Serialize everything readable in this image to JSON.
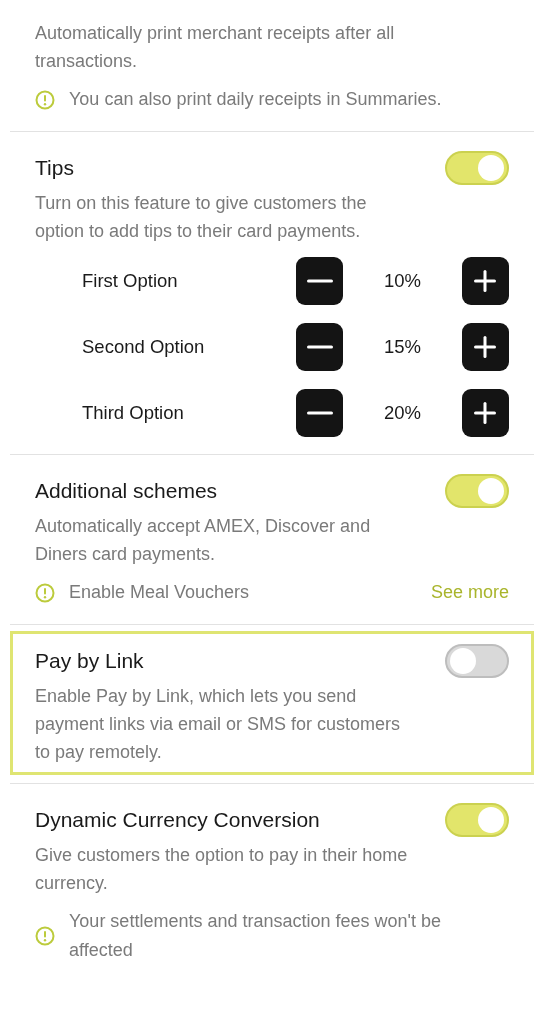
{
  "sections": [
    {
      "kind": "info",
      "highlighted": false,
      "description": "Automatically print merchant receipts after all transactions.",
      "notice": "You can also print daily receipts in Summaries."
    },
    {
      "kind": "toggle",
      "highlighted": false,
      "title": "Tips",
      "on": true,
      "description": "Turn on this feature to give customers the option to add tips to their card payments.",
      "options": [
        {
          "label": "First Option",
          "value": "10%"
        },
        {
          "label": "Second Option",
          "value": "15%"
        },
        {
          "label": "Third Option",
          "value": "20%"
        }
      ]
    },
    {
      "kind": "toggle",
      "highlighted": false,
      "title": "Additional schemes",
      "on": true,
      "description": "Automatically accept AMEX, Discover and Diners card payments.",
      "notice": "Enable Meal Vouchers",
      "link": "See more"
    },
    {
      "kind": "toggle",
      "highlighted": true,
      "title": "Pay by Link",
      "on": false,
      "description": "Enable Pay by Link, which lets you send payment links via email or SMS for customers to pay remotely."
    },
    {
      "kind": "toggle",
      "highlighted": false,
      "title": "Dynamic Currency Conversion",
      "on": true,
      "description": "Give customers the option to pay in their home currency.",
      "notice": "Your settlements and transaction fees won't be affected"
    }
  ]
}
